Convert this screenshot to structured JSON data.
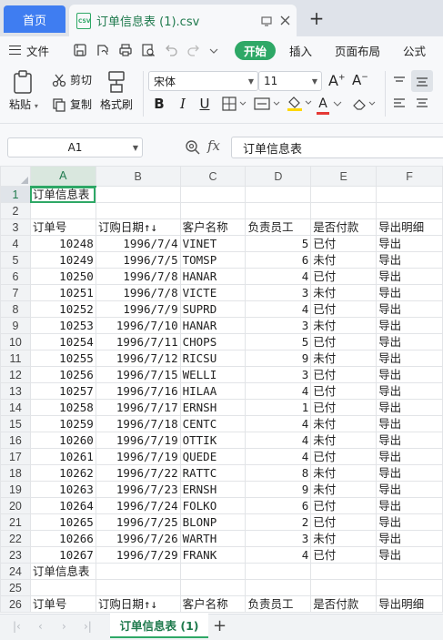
{
  "tabs": {
    "home_label": "首页",
    "file_title": "订单信息表 (1).csv",
    "csv_icon_text": "CSV",
    "new_tab": "+"
  },
  "ribbon": {
    "menu_label": "文件",
    "tabs": [
      {
        "label": "开始",
        "active": true
      },
      {
        "label": "插入",
        "active": false
      },
      {
        "label": "页面布局",
        "active": false
      },
      {
        "label": "公式",
        "active": false
      }
    ],
    "paste_label": "粘贴",
    "cut_label": "剪切",
    "copy_label": "复制",
    "format_painter_label": "格式刷",
    "font_name": "宋体",
    "font_size": "11",
    "bold": "B",
    "italic": "I",
    "underline": "U",
    "font_color_letter": "A",
    "accent_green": "#2ea866",
    "accent_blue": "#3f7df1"
  },
  "formula_bar": {
    "name_box": "A1",
    "fx": "fx",
    "content": "订单信息表"
  },
  "sheet": {
    "columns": [
      "A",
      "B",
      "C",
      "D",
      "E",
      "F"
    ],
    "selected_column": "A",
    "rows": [
      {
        "n": "1",
        "a": "订单信息表",
        "b": "",
        "c": "",
        "d": "",
        "e": "",
        "f": ""
      },
      {
        "n": "2",
        "a": "",
        "b": "",
        "c": "",
        "d": "",
        "e": "",
        "f": ""
      },
      {
        "n": "3",
        "a": "订单号",
        "b": "订购日期↑↓",
        "c": "客户名称",
        "d": "负责员工",
        "e": "是否付款",
        "f": "导出明细"
      },
      {
        "n": "4",
        "a": "10248",
        "b": "1996/7/4",
        "c": "VINET",
        "d": "5",
        "e": "已付",
        "f": "导出"
      },
      {
        "n": "5",
        "a": "10249",
        "b": "1996/7/5",
        "c": "TOMSP",
        "d": "6",
        "e": "未付",
        "f": "导出"
      },
      {
        "n": "6",
        "a": "10250",
        "b": "1996/7/8",
        "c": "HANAR",
        "d": "4",
        "e": "已付",
        "f": "导出"
      },
      {
        "n": "7",
        "a": "10251",
        "b": "1996/7/8",
        "c": "VICTE",
        "d": "3",
        "e": "未付",
        "f": "导出"
      },
      {
        "n": "8",
        "a": "10252",
        "b": "1996/7/9",
        "c": "SUPRD",
        "d": "4",
        "e": "已付",
        "f": "导出"
      },
      {
        "n": "9",
        "a": "10253",
        "b": "1996/7/10",
        "c": "HANAR",
        "d": "3",
        "e": "未付",
        "f": "导出"
      },
      {
        "n": "10",
        "a": "10254",
        "b": "1996/7/11",
        "c": "CHOPS",
        "d": "5",
        "e": "已付",
        "f": "导出"
      },
      {
        "n": "11",
        "a": "10255",
        "b": "1996/7/12",
        "c": "RICSU",
        "d": "9",
        "e": "未付",
        "f": "导出"
      },
      {
        "n": "12",
        "a": "10256",
        "b": "1996/7/15",
        "c": "WELLI",
        "d": "3",
        "e": "已付",
        "f": "导出"
      },
      {
        "n": "13",
        "a": "10257",
        "b": "1996/7/16",
        "c": "HILAA",
        "d": "4",
        "e": "已付",
        "f": "导出"
      },
      {
        "n": "14",
        "a": "10258",
        "b": "1996/7/17",
        "c": "ERNSH",
        "d": "1",
        "e": "已付",
        "f": "导出"
      },
      {
        "n": "15",
        "a": "10259",
        "b": "1996/7/18",
        "c": "CENTC",
        "d": "4",
        "e": "未付",
        "f": "导出"
      },
      {
        "n": "16",
        "a": "10260",
        "b": "1996/7/19",
        "c": "OTTIK",
        "d": "4",
        "e": "未付",
        "f": "导出"
      },
      {
        "n": "17",
        "a": "10261",
        "b": "1996/7/19",
        "c": "QUEDE",
        "d": "4",
        "e": "已付",
        "f": "导出"
      },
      {
        "n": "18",
        "a": "10262",
        "b": "1996/7/22",
        "c": "RATTC",
        "d": "8",
        "e": "未付",
        "f": "导出"
      },
      {
        "n": "19",
        "a": "10263",
        "b": "1996/7/23",
        "c": "ERNSH",
        "d": "9",
        "e": "未付",
        "f": "导出"
      },
      {
        "n": "20",
        "a": "10264",
        "b": "1996/7/24",
        "c": "FOLKO",
        "d": "6",
        "e": "已付",
        "f": "导出"
      },
      {
        "n": "21",
        "a": "10265",
        "b": "1996/7/25",
        "c": "BLONP",
        "d": "2",
        "e": "已付",
        "f": "导出"
      },
      {
        "n": "22",
        "a": "10266",
        "b": "1996/7/26",
        "c": "WARTH",
        "d": "3",
        "e": "未付",
        "f": "导出"
      },
      {
        "n": "23",
        "a": "10267",
        "b": "1996/7/29",
        "c": "FRANK",
        "d": "4",
        "e": "已付",
        "f": "导出"
      },
      {
        "n": "24",
        "a": "订单信息表",
        "b": "",
        "c": "",
        "d": "",
        "e": "",
        "f": ""
      },
      {
        "n": "25",
        "a": "",
        "b": "",
        "c": "",
        "d": "",
        "e": "",
        "f": ""
      },
      {
        "n": "26",
        "a": "订单号",
        "b": "订购日期↑↓",
        "c": "客户名称",
        "d": "负责员工",
        "e": "是否付款",
        "f": "导出明细"
      }
    ]
  },
  "sheet_tabs": {
    "active": "订单信息表 (1)",
    "add": "+"
  }
}
